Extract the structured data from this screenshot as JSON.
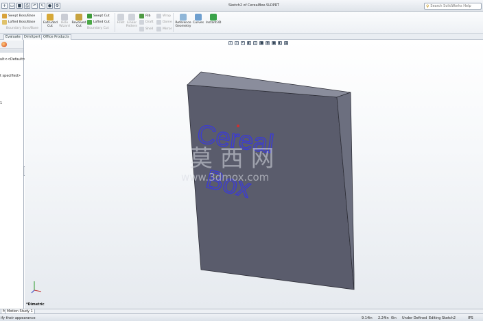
{
  "window": {
    "title": "Sketch2 of CerealBox.SLDPRT",
    "help_search_placeholder": "Search SolidWorks Help"
  },
  "ribbon": {
    "swept_boss": "Swept Boss/Base",
    "lofted_boss": "Lofted Boss/Base",
    "boundary_boss": "Boundary Boss/Base",
    "extruded_cut": [
      "Extruded",
      "Cut"
    ],
    "hole_wizard": [
      "Hole",
      "Wizard"
    ],
    "revolved_cut": [
      "Revolved",
      "Cut"
    ],
    "swept_cut": "Swept Cut",
    "lofted_cut": "Lofted Cut",
    "boundary_cut": "Boundary Cut",
    "fillet": "Fillet",
    "linear_pattern": [
      "Linear",
      "Pattern"
    ],
    "rib": "Rib",
    "draft": "Draft",
    "shell": "Shell",
    "wrap": "Wrap",
    "dome": "Dome",
    "mirror": "Mirror",
    "reference_geometry": [
      "Reference",
      "Geometry"
    ],
    "curves": "Curves",
    "instant3d": "Instant3D"
  },
  "command_tabs": [
    "Evaluate",
    "DimXpert",
    "Office Products"
  ],
  "feature_manager": {
    "material_row": "ult<<Default>",
    "not_specified": "t specified>",
    "row_marker": "1"
  },
  "model": {
    "text_line1": "Cereal",
    "text_line2": "Box",
    "text_color": "#3b3bd4",
    "box_front_color": "#5a5c6c",
    "box_top_color": "#8a8d9c",
    "box_side_color": "#6c6f7f"
  },
  "watermark": {
    "cn": "莫 西 网",
    "url": "www.3dmox.com"
  },
  "viewport": {
    "view_orientation": "*Dimetric"
  },
  "bottom_tabs": [
    "Model",
    "Motion Study 1"
  ],
  "status_bar": {
    "hint": "ify their appearance",
    "x": "9.14in",
    "y": "2.24in",
    "z": "0in",
    "definition": "Under Defined",
    "editing": "Editing Sketch2",
    "units": "IPS"
  }
}
